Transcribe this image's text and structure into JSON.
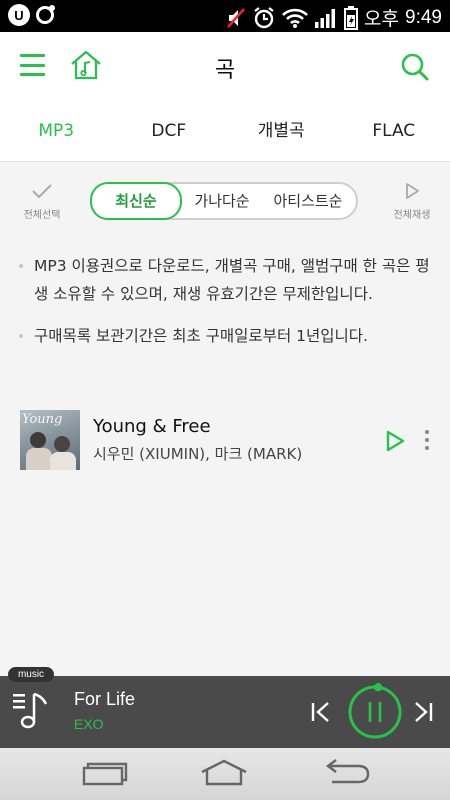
{
  "status_bar": {
    "app_badge": "U",
    "ampm": "오후",
    "time": "9:49"
  },
  "header": {
    "title": "곡",
    "icons": [
      "menu-icon",
      "home-music-icon",
      "search-icon"
    ]
  },
  "tabs": [
    {
      "label": "MP3",
      "active": true
    },
    {
      "label": "DCF",
      "active": false
    },
    {
      "label": "개별곡",
      "active": false
    },
    {
      "label": "FLAC",
      "active": false
    }
  ],
  "sort_bar": {
    "select_all_label": "전체선택",
    "play_all_label": "전체재생",
    "options": [
      "최신순",
      "가나다순",
      "아티스트순"
    ],
    "selected": "최신순"
  },
  "notes": [
    "MP3 이용권으로 다운로드, 개별곡 구매, 앨범구매 한 곡은 평생 소유할 수 있으며, 재생 유효기간은 무제한입니다.",
    "구매목록 보관기간은 최초 구매일로부터 1년입니다."
  ],
  "songs": [
    {
      "title": "Young & Free",
      "artist": "시우민 (XIUMIN), 마크 (MARK)",
      "album_art_text": "Young"
    }
  ],
  "mini_player": {
    "badge": "music",
    "title": "For Life",
    "artist": "EXO",
    "progress": 0.02,
    "state": "playing"
  },
  "colors": {
    "accent": "#26c24a",
    "player_bg": "#4a4a4a",
    "statusbar_bg": "#000000"
  }
}
